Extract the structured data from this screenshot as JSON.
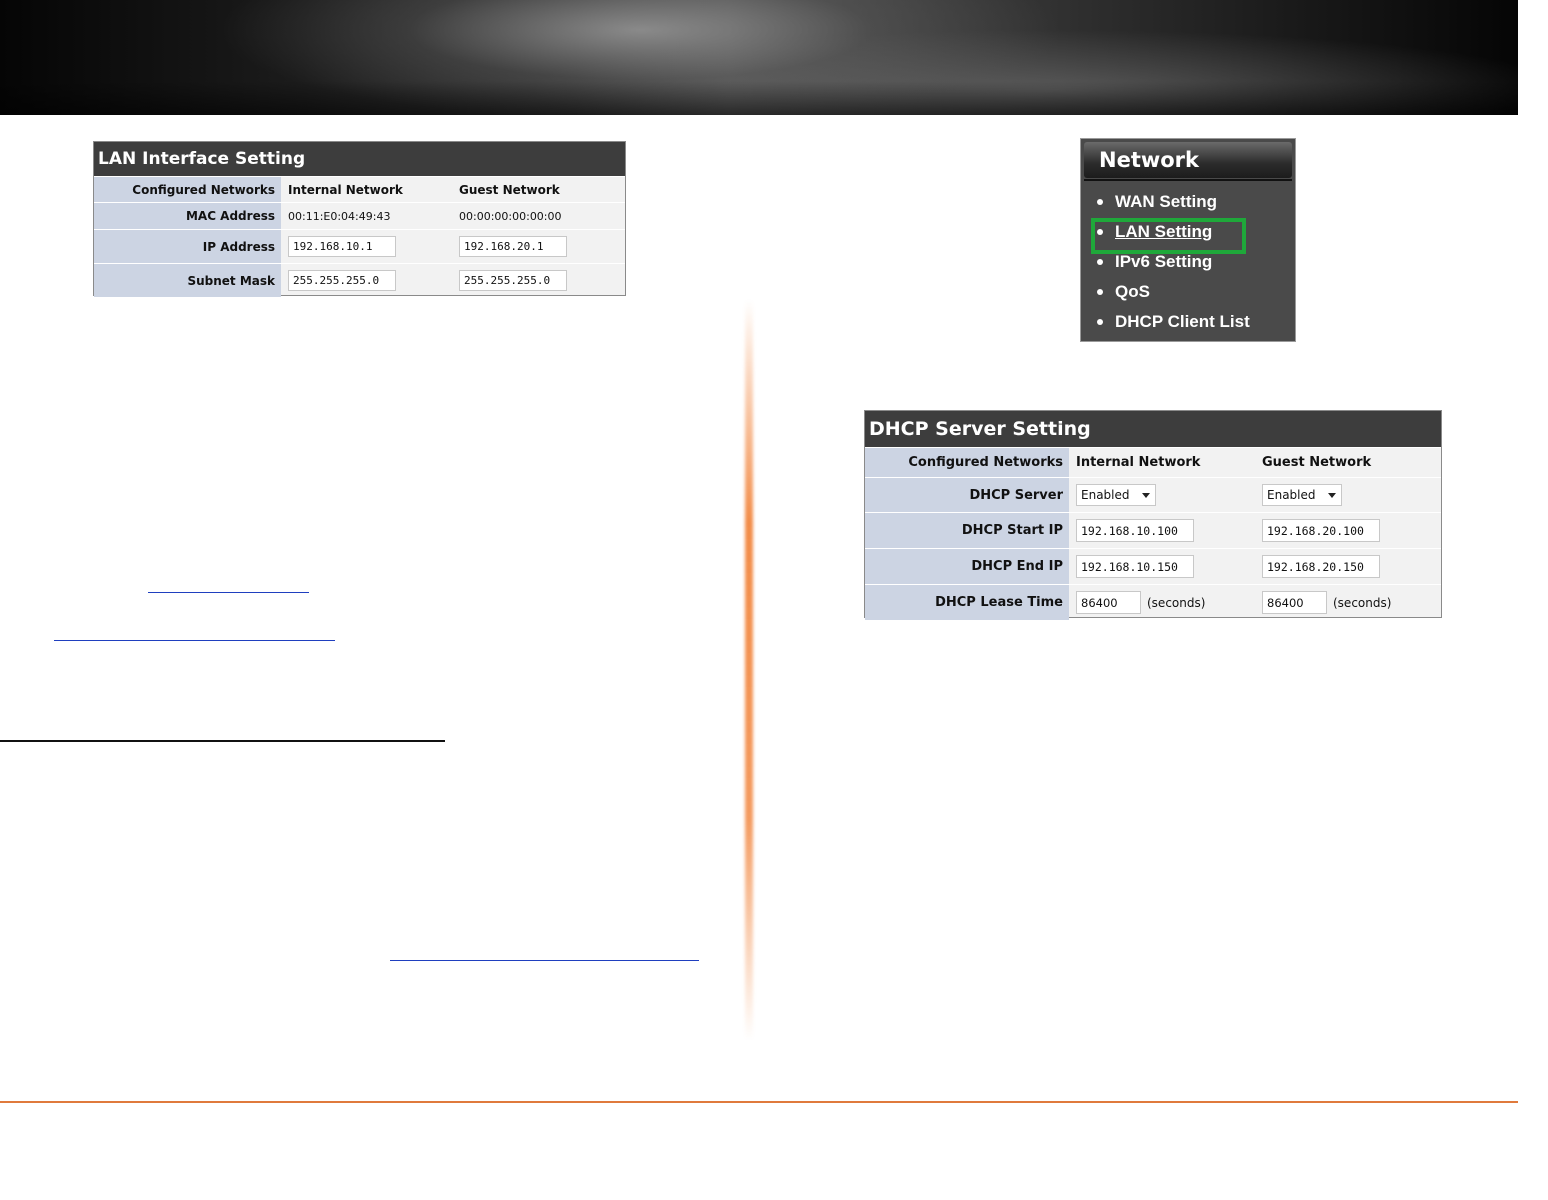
{
  "lan_table": {
    "title": "LAN Interface Setting",
    "rows": [
      {
        "label": "Configured Networks",
        "internal": "Internal Network",
        "guest": "Guest Network"
      },
      {
        "label": "MAC Address",
        "internal": "00:11:E0:04:49:43",
        "guest": "00:00:00:00:00:00"
      },
      {
        "label": "IP Address",
        "internal": "192.168.10.1",
        "guest": "192.168.20.1"
      },
      {
        "label": "Subnet Mask",
        "internal": "255.255.255.0",
        "guest": "255.255.255.0"
      }
    ]
  },
  "network_menu": {
    "title": "Network",
    "items": [
      "WAN Setting",
      "LAN Setting",
      "IPv6 Setting",
      "QoS",
      "DHCP Client List"
    ],
    "active_item": "LAN Setting",
    "highlight_color": "#1fa83a"
  },
  "dhcp_table": {
    "title": "DHCP Server Setting",
    "rows": [
      {
        "label": "Configured Networks",
        "internal": "Internal Network",
        "guest": "Guest Network"
      },
      {
        "label": "DHCP Server",
        "internal": "Enabled",
        "guest": "Enabled"
      },
      {
        "label": "DHCP Start IP",
        "internal": "192.168.10.100",
        "guest": "192.168.20.100"
      },
      {
        "label": "DHCP End IP",
        "internal": "192.168.10.150",
        "guest": "192.168.20.150"
      },
      {
        "label": "DHCP Lease Time",
        "internal": "86400",
        "guest": "86400",
        "unit": "(seconds)"
      }
    ]
  },
  "colors": {
    "accent_orange": "#e07a3c",
    "table_header": "#3d3d3d",
    "label_column": "#ccd4e3",
    "link_blue": "#1f3fbf"
  }
}
